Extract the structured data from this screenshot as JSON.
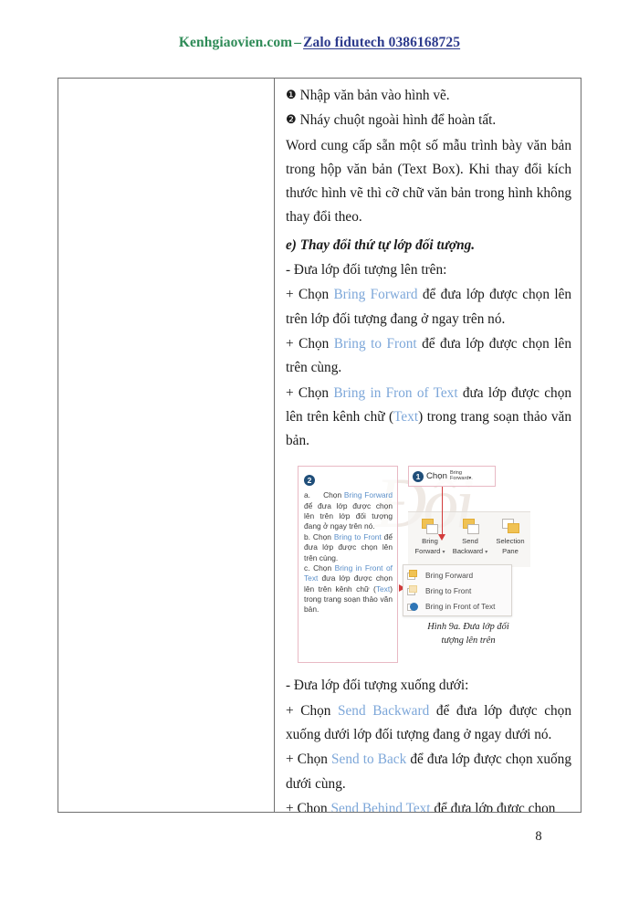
{
  "header": {
    "site": "Kenhgiaovien.com",
    "separator": "–",
    "zalo": "Zalo fidutech 0386168725"
  },
  "body": {
    "item2_bullet": "❶",
    "item2_text": "Nhập văn bản vào hình vẽ.",
    "item3_bullet": "❷",
    "item3_text": "Nháy chuột ngoài hình để hoàn tất.",
    "para_word": "Word cung cấp sẵn một số mẫu trình bày văn bản trong hộp văn bản (Text Box). Khi thay đổi kích thước hình vẽ thì cỡ chữ văn bản trong hình không thay đổi theo.",
    "heading_e": "e) Thay đổi thứ tự lớp đối tượng.",
    "sub_up": "- Đưa lớp đối tượng lên trên:",
    "up1_pre": "+ Chọn ",
    "up1_en": "Bring Forward",
    "up1_post": " để đưa lớp được chọn lên trên lớp đối tượng đang ở ngay trên nó.",
    "up2_pre": "+ Chọn ",
    "up2_en": "Bring to Front",
    "up2_post": " để đưa lớp được chọn lên trên cùng.",
    "up3_pre": "+ Chọn ",
    "up3_en": "Bring in Fron of Text",
    "up3_mid": " đưa lớp được chọn lên trên kênh chữ (",
    "up3_en2": "Text",
    "up3_post": ") trong trang soạn thảo văn bản.",
    "sub_down": "- Đưa lớp đối tượng xuống dưới:",
    "dn1_pre": "+ Chọn ",
    "dn1_en": "Send Backward",
    "dn1_post": " để đưa lớp được chọn xuống dưới lớp đối tượng đang ở ngay dưới nó.",
    "dn2_pre": "+ Chọn ",
    "dn2_en": "Send to Back",
    "dn2_post": " để đưa lớp được chọn xuống dưới cùng.",
    "dn3_pre": "+ Chọn ",
    "dn3_en": "Send Behind Text",
    "dn3_post": " để đưa lớp được chọn"
  },
  "figure": {
    "note": {
      "marker": "❷",
      "a_pre": "a.     Chọn ",
      "a_en": "Bring Forward",
      "a_post": " để đưa lớp được chọn lên trên lớp đối tượng đang ở ngay trên nó.",
      "b_pre": "b. Chọn ",
      "b_en": "Bring to Front",
      "b_post": " để đưa lớp được chọn lên trên cùng.",
      "c_pre": "c. Chọn ",
      "c_en": "Bring in Front of Text",
      "c_mid": " đưa lớp được chọn lên trên kênh chữ (",
      "c_en2": "Text",
      "c_post": ") trong trang soạn thảo văn bản."
    },
    "callout": {
      "marker": "❶",
      "text": "Chọn",
      "small_line1": "Bring",
      "small_line2": "Forward▾."
    },
    "ribbon": [
      {
        "line1": "Bring",
        "line2": "Forward"
      },
      {
        "line1": "Send",
        "line2": "Backward"
      },
      {
        "line1": "Selection",
        "line2": "Pane"
      }
    ],
    "dropdown": [
      "Bring Forward",
      "Bring to Front",
      "Bring in Front of Text"
    ],
    "caption_line1": "Hình 9a. Đưa lớp đối",
    "caption_line2": "tượng lên trên",
    "watermark": "Đối"
  },
  "footer": {
    "page_number": "8"
  },
  "colors": {
    "brand_green": "#2e8b57",
    "link_blue": "#2c3a8c",
    "en_term_blue": "#7da7d9",
    "accent_pink": "#e8b9c4",
    "arrow_red": "#d23b3b",
    "gold": "#f0c254",
    "table_border": "#6f6f6f"
  }
}
